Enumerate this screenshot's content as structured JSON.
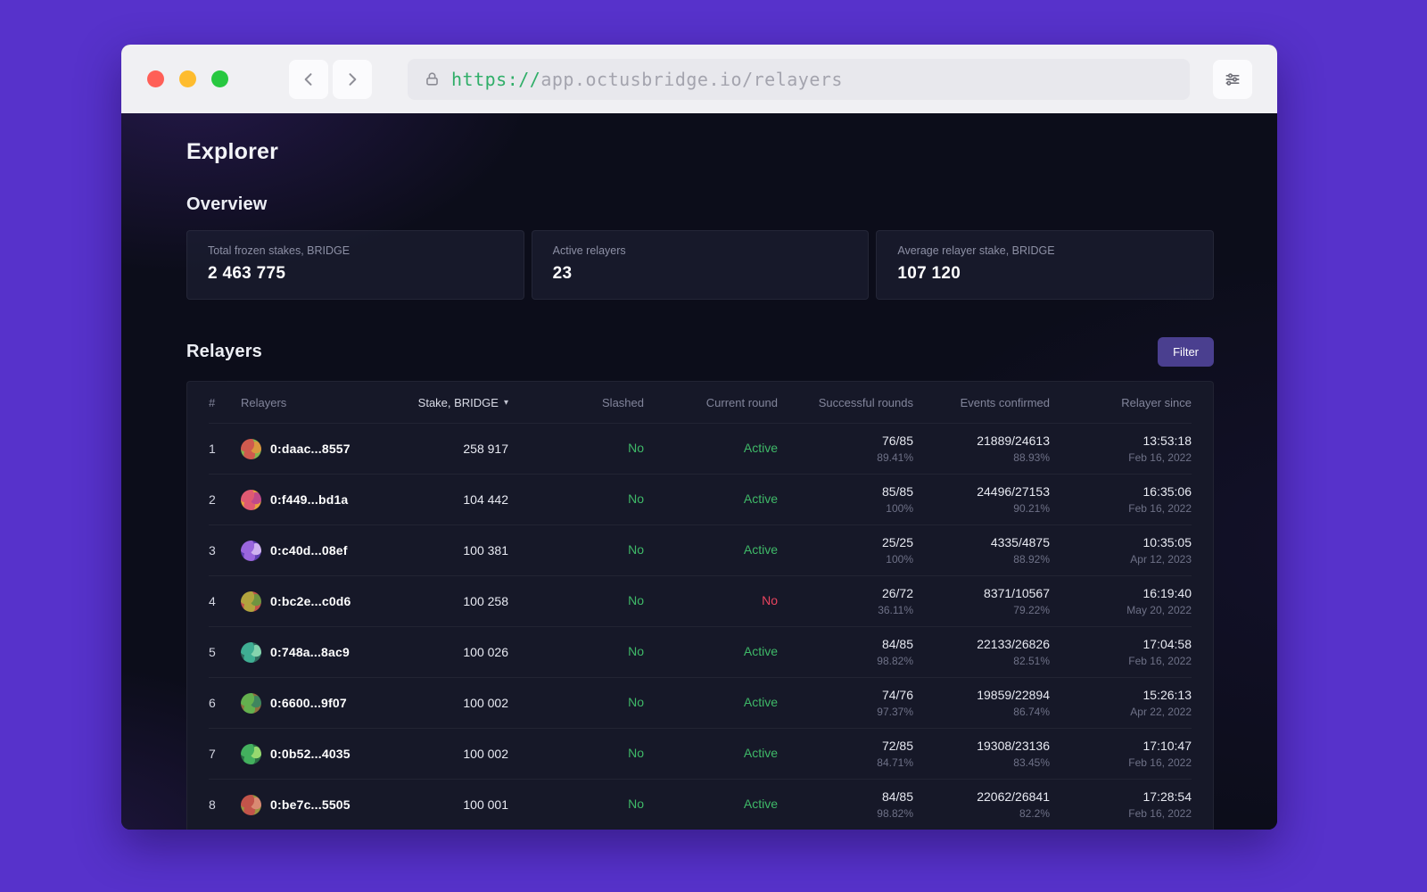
{
  "browser": {
    "url_scheme": "https://",
    "url_rest": "app.octusbridge.io/relayers"
  },
  "page": {
    "title": "Explorer",
    "overview": {
      "heading": "Overview",
      "cards": [
        {
          "label": "Total frozen stakes, BRIDGE",
          "value": "2 463 775"
        },
        {
          "label": "Active relayers",
          "value": "23"
        },
        {
          "label": "Average relayer stake, BRIDGE",
          "value": "107 120"
        }
      ]
    },
    "relayers": {
      "heading": "Relayers",
      "filter_label": "Filter",
      "table": {
        "columns": [
          "#",
          "Relayers",
          "Stake, BRIDGE",
          "Slashed",
          "Current round",
          "Successful rounds",
          "Events confirmed",
          "Relayer since"
        ],
        "sort_caret": "▾",
        "rows": [
          {
            "n": "1",
            "address": "0:daac...8557",
            "stake": "258 917",
            "slashed": "No",
            "round": "Active",
            "round_status": "active",
            "rounds": "76/85",
            "rounds_pct": "89.41%",
            "events": "21889/24613",
            "events_pct": "88.93%",
            "time": "13:53:18",
            "date": "Feb 16, 2022",
            "avatar": [
              "#cf5a4e",
              "#84b44e",
              "#d9973f"
            ]
          },
          {
            "n": "2",
            "address": "0:f449...bd1a",
            "stake": "104 442",
            "slashed": "No",
            "round": "Active",
            "round_status": "active",
            "rounds": "85/85",
            "rounds_pct": "100%",
            "events": "24496/27153",
            "events_pct": "90.21%",
            "time": "16:35:06",
            "date": "Feb 16, 2022",
            "avatar": [
              "#e05a72",
              "#e8a23e",
              "#c04a8a"
            ]
          },
          {
            "n": "3",
            "address": "0:c40d...08ef",
            "stake": "100 381",
            "slashed": "No",
            "round": "Active",
            "round_status": "active",
            "rounds": "25/25",
            "rounds_pct": "100%",
            "events": "4335/4875",
            "events_pct": "88.92%",
            "time": "10:35:05",
            "date": "Apr 12, 2023",
            "avatar": [
              "#9a66dd",
              "#5f3fb2",
              "#cfb2f0"
            ]
          },
          {
            "n": "4",
            "address": "0:bc2e...c0d6",
            "stake": "100 258",
            "slashed": "No",
            "round": "No",
            "round_status": "inactive",
            "rounds": "26/72",
            "rounds_pct": "36.11%",
            "events": "8371/10567",
            "events_pct": "79.22%",
            "time": "16:19:40",
            "date": "May 20, 2022",
            "avatar": [
              "#b2a43e",
              "#c2544a",
              "#6f9440"
            ]
          },
          {
            "n": "5",
            "address": "0:748a...8ac9",
            "stake": "100 026",
            "slashed": "No",
            "round": "Active",
            "round_status": "active",
            "rounds": "84/85",
            "rounds_pct": "98.82%",
            "events": "22133/26826",
            "events_pct": "82.51%",
            "time": "17:04:58",
            "date": "Feb 16, 2022",
            "avatar": [
              "#3fae93",
              "#2f6b5e",
              "#85d4ae"
            ]
          },
          {
            "n": "6",
            "address": "0:6600...9f07",
            "stake": "100 002",
            "slashed": "No",
            "round": "Active",
            "round_status": "active",
            "rounds": "74/76",
            "rounds_pct": "97.37%",
            "events": "19859/22894",
            "events_pct": "86.74%",
            "time": "15:26:13",
            "date": "Apr 22, 2022",
            "avatar": [
              "#64b04e",
              "#8f6f3e",
              "#3f855e"
            ]
          },
          {
            "n": "7",
            "address": "0:0b52...4035",
            "stake": "100 002",
            "slashed": "No",
            "round": "Active",
            "round_status": "active",
            "rounds": "72/85",
            "rounds_pct": "84.71%",
            "events": "19308/23136",
            "events_pct": "83.45%",
            "time": "17:10:47",
            "date": "Feb 16, 2022",
            "avatar": [
              "#43b05e",
              "#2a7043",
              "#96d96f"
            ]
          },
          {
            "n": "8",
            "address": "0:be7c...5505",
            "stake": "100 001",
            "slashed": "No",
            "round": "Active",
            "round_status": "active",
            "rounds": "84/85",
            "rounds_pct": "98.82%",
            "events": "22062/26841",
            "events_pct": "82.2%",
            "time": "17:28:54",
            "date": "Feb 16, 2022",
            "avatar": [
              "#c2544a",
              "#9a9440",
              "#d98a72"
            ]
          }
        ]
      }
    }
  },
  "colors": {
    "accent_purple": "#5732cb",
    "positive_green": "#3fb968",
    "negative_red": "#e8445e",
    "filter_button": "#4a3f8f"
  }
}
